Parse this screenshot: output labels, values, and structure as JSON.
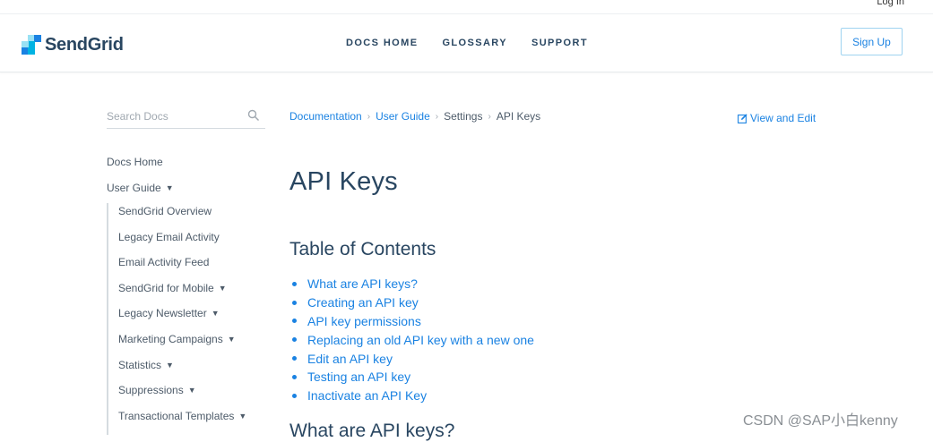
{
  "header": {
    "login_label": "Log In",
    "brand": "SendGrid",
    "nav": [
      "DOCS HOME",
      "GLOSSARY",
      "SUPPORT"
    ],
    "signup_label": "Sign Up"
  },
  "search": {
    "placeholder": "Search Docs",
    "value": ""
  },
  "sidebar": {
    "top_items": [
      "Docs Home",
      "User Guide"
    ],
    "sub_items": [
      {
        "label": "SendGrid Overview",
        "expandable": false
      },
      {
        "label": "Legacy Email Activity",
        "expandable": false
      },
      {
        "label": "Email Activity Feed",
        "expandable": false
      },
      {
        "label": "SendGrid for Mobile",
        "expandable": true
      },
      {
        "label": "Legacy Newsletter",
        "expandable": true
      },
      {
        "label": "Marketing Campaigns",
        "expandable": true
      },
      {
        "label": "Statistics",
        "expandable": true
      },
      {
        "label": "Suppressions",
        "expandable": true
      },
      {
        "label": "Transactional Templates",
        "expandable": true
      }
    ],
    "caret_glyph": "▼"
  },
  "breadcrumb": [
    "Documentation",
    "User Guide",
    "Settings",
    "API Keys"
  ],
  "breadcrumb_sep": "›",
  "view_edit_label": "View and Edit",
  "page": {
    "title": "API Keys",
    "toc_title": "Table of Contents",
    "toc": [
      "What are API keys?",
      "Creating an API key",
      "API key permissions",
      "Replacing an old API key with a new one",
      "Edit an API key",
      "Testing an API key",
      "Inactivate an API Key"
    ],
    "section_heading": "What are API keys?"
  },
  "watermark": "CSDN @SAP小白kenny",
  "colors": {
    "brand_navy": "#294661",
    "link_blue": "#1a82e2",
    "logo_blues": [
      "#1a82e2",
      "#00b3e3",
      "#99e1f4",
      "#1a82e2"
    ]
  },
  "icons": [
    "sendgrid-logo-icon",
    "search-icon",
    "edit-icon",
    "bullet-icon",
    "caret-down-icon"
  ]
}
